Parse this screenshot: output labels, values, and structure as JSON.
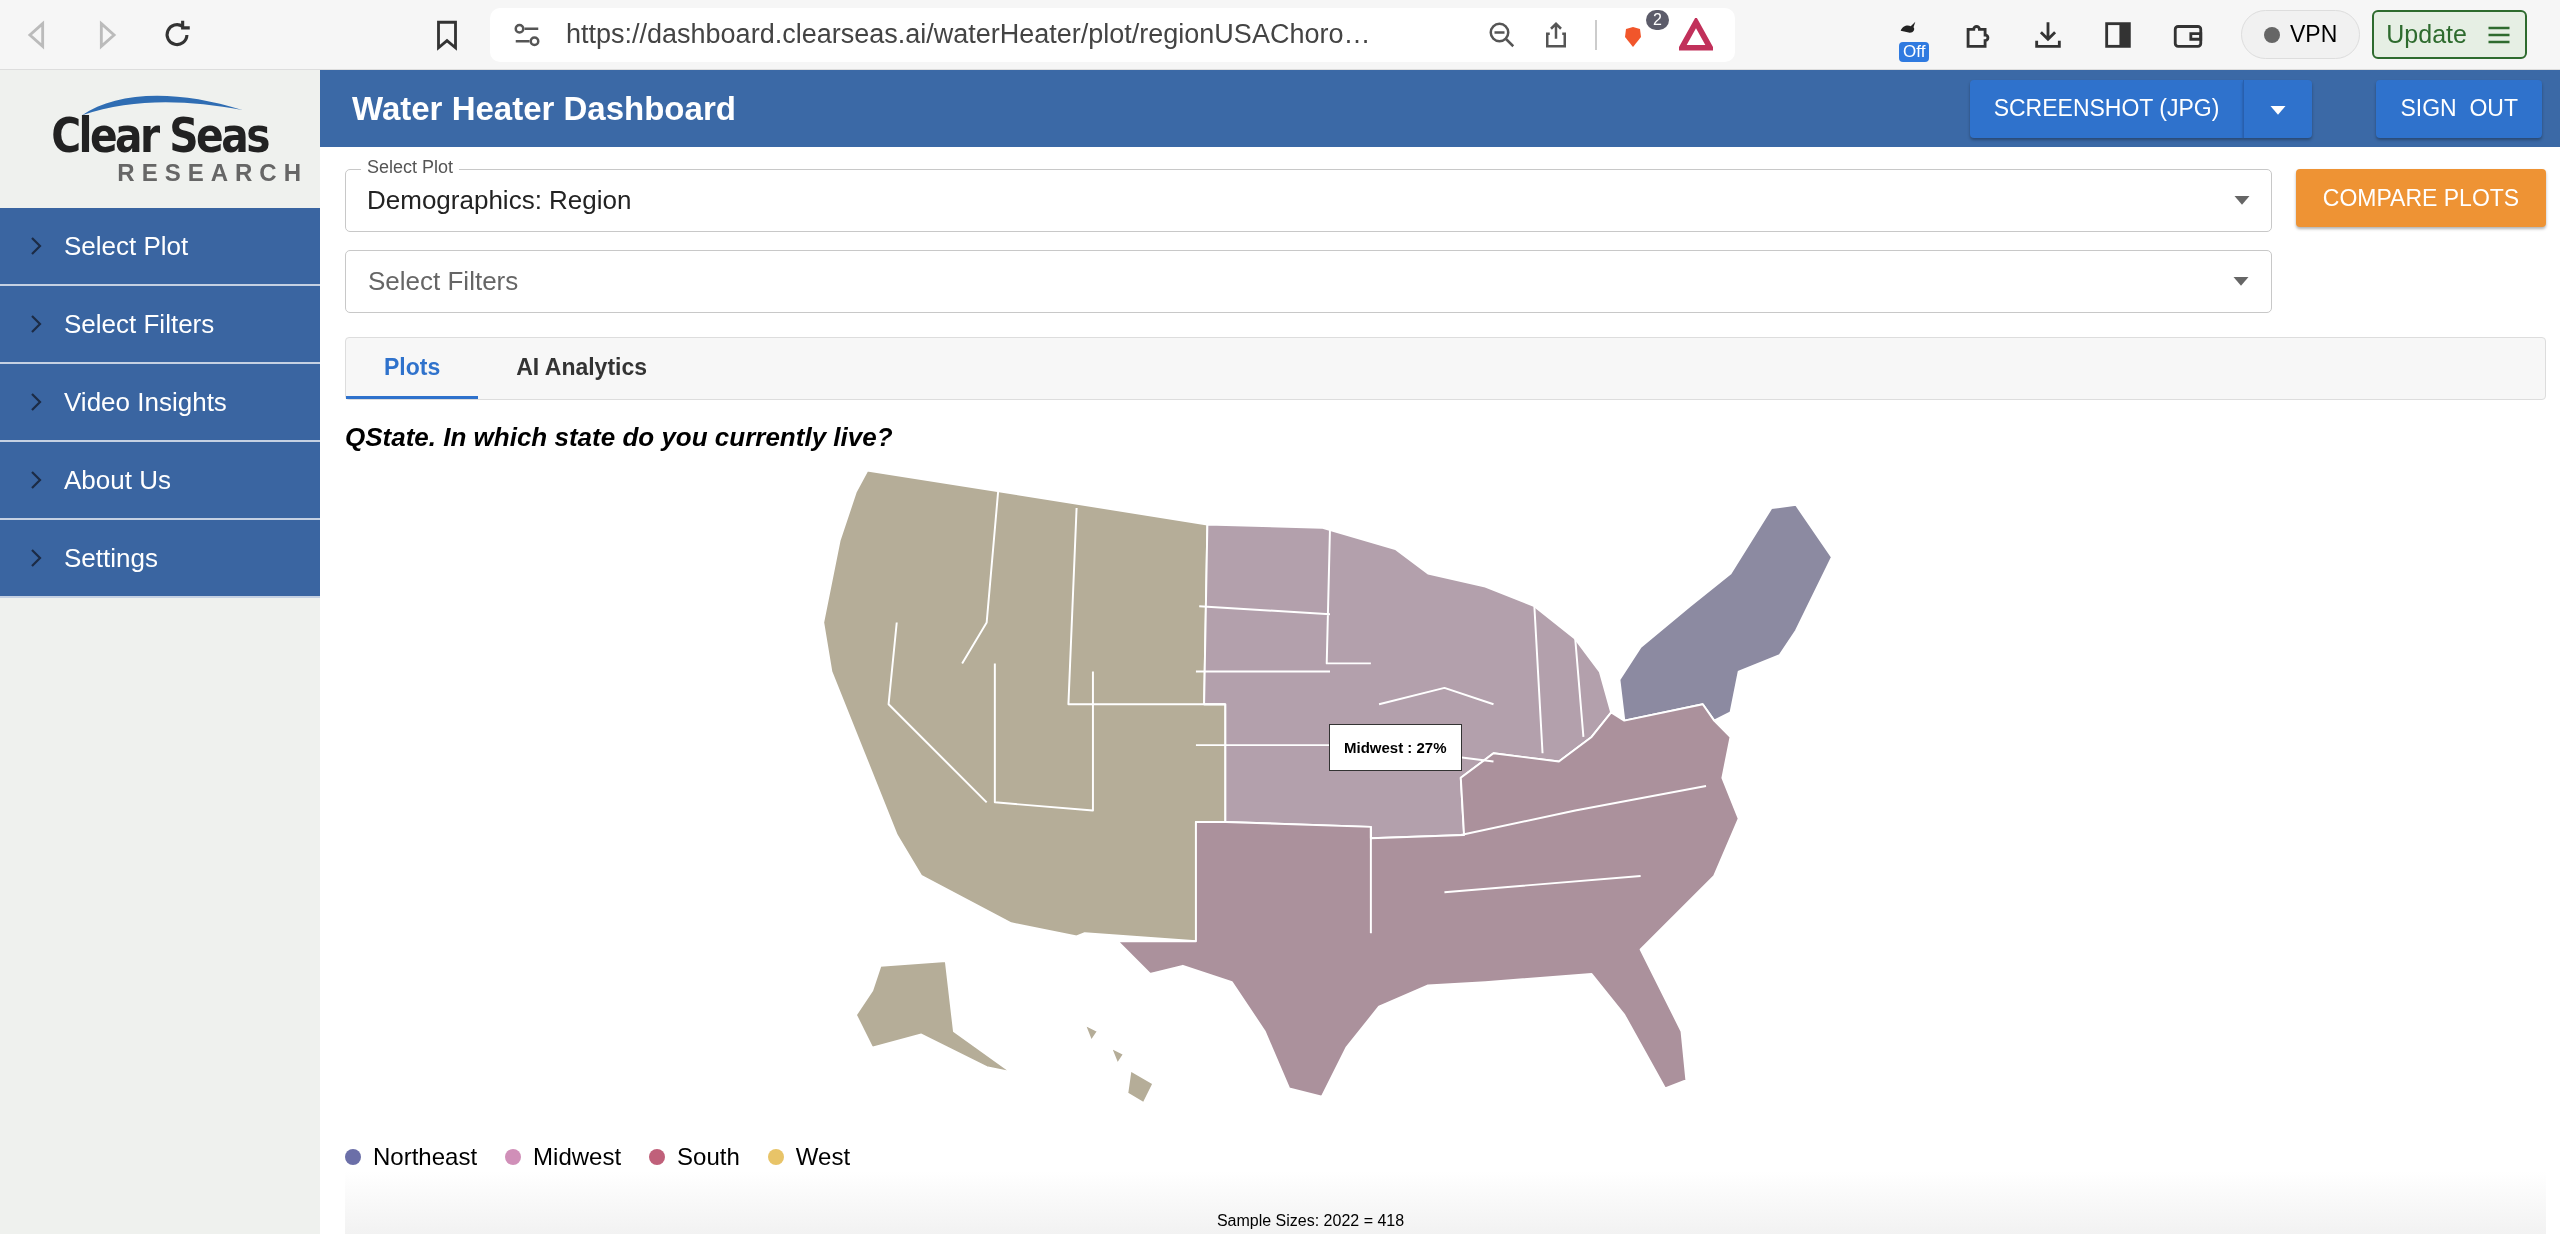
{
  "browser": {
    "url": "https://dashboard.clearseas.ai/waterHeater/plot/regionUSAChoro…",
    "shields_count": "2",
    "extension_badge": "Off",
    "vpn": "VPN",
    "update": "Update"
  },
  "logo": {
    "name": "Clear Seas",
    "tagline": "RESEARCH"
  },
  "sidebar": {
    "items": [
      {
        "label": "Select Plot"
      },
      {
        "label": "Select Filters"
      },
      {
        "label": "Video Insights"
      },
      {
        "label": "About Us"
      },
      {
        "label": "Settings"
      }
    ]
  },
  "header": {
    "title": "Water Heater Dashboard",
    "screenshot_button": "SCREENSHOT (JPG)",
    "sign_out_button": "SIGN  OUT"
  },
  "select_plot": {
    "label": "Select Plot",
    "value": "Demographics: Region"
  },
  "compare_button": "COMPARE PLOTS",
  "select_filters": {
    "placeholder": "Select Filters"
  },
  "tabs": [
    {
      "label": "Plots",
      "selected": true
    },
    {
      "label": "AI Analytics",
      "selected": false
    }
  ],
  "question": "QState. In which state do you currently live?",
  "map": {
    "tooltip": "Midwest : 27%",
    "legend": [
      {
        "label": "Northeast",
        "color": "#6b6fa8"
      },
      {
        "label": "Midwest",
        "color": "#d08fb8"
      },
      {
        "label": "South",
        "color": "#c0607a"
      },
      {
        "label": "West",
        "color": "#e8c468"
      }
    ]
  },
  "sample_sizes": "Sample Sizes: 2022 = 418"
}
